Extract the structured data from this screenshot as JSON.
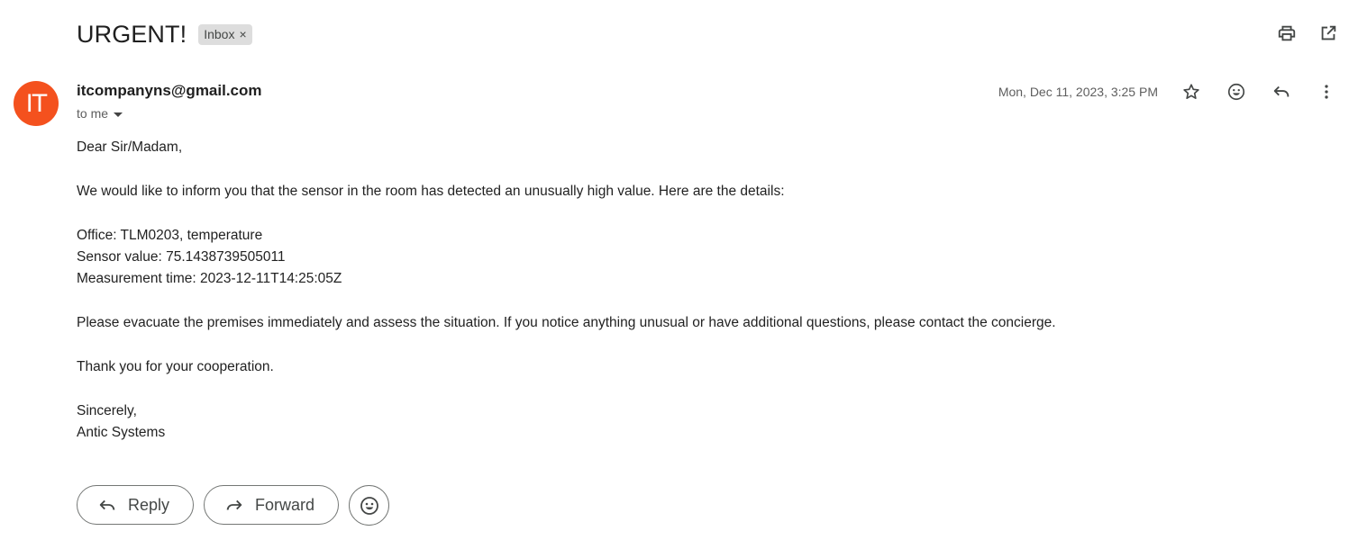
{
  "email": {
    "subject": "URGENT!",
    "label": "Inbox",
    "label_remove": "×",
    "avatar_initials": "IT",
    "avatar_color": "#f4511e",
    "sender": "itcompanyns@gmail.com",
    "recipient": "to me",
    "date": "Mon, Dec 11, 2023, 3:25 PM",
    "body": {
      "greeting": "Dear Sir/Madam,",
      "intro": "We would like to inform you that the sensor in the room has detected an unusually high value. Here are the details:",
      "office": "Office: TLM0203, temperature",
      "sensor_value": "Sensor value: 75.1438739505011",
      "measurement_time": "Measurement time: 2023-12-11T14:25:05Z",
      "instructions": "Please evacuate the premises immediately and assess the situation. If you notice anything unusual or have additional questions, please contact the concierge.",
      "thanks": "Thank you for your cooperation.",
      "closing": "Sincerely,",
      "signature": "Antic Systems"
    }
  },
  "actions": {
    "reply_label": "Reply",
    "forward_label": "Forward"
  },
  "icons": {
    "print": "print-icon",
    "open_new": "open-in-new-icon",
    "star": "star-icon",
    "emoji": "emoji-icon",
    "reply": "reply-icon",
    "more": "more-vert-icon",
    "forward": "forward-icon"
  }
}
